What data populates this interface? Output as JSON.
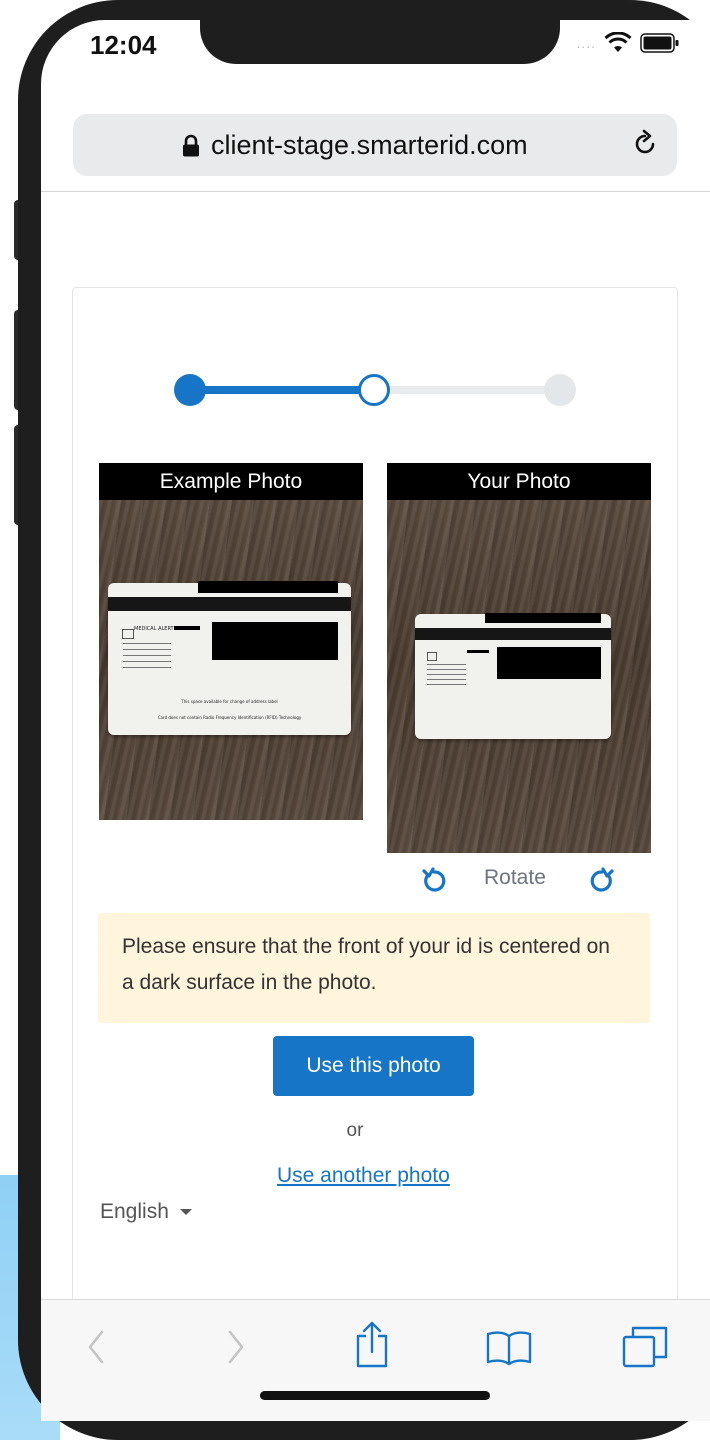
{
  "status_bar": {
    "time": "12:04"
  },
  "browser": {
    "url": "client-stage.smarterid.com"
  },
  "progress": {
    "current_step": 2,
    "total_steps": 3
  },
  "photos": {
    "example_title": "Example Photo",
    "yours_title": "Your Photo",
    "card_text_1": "MEDICAL ALERT",
    "card_text_2": "This space available for change of address label",
    "card_text_3": "Card does not contain Radio Frequency Identification (RFID) Technology"
  },
  "rotate": {
    "label": "Rotate"
  },
  "notice": {
    "text": "Please ensure that the front of your id is centered on a dark surface in the photo."
  },
  "actions": {
    "use_photo": "Use this photo",
    "or": "or",
    "use_another": "Use another photo"
  },
  "language": {
    "selected": "English"
  },
  "colors": {
    "accent": "#1775c7",
    "notice_bg": "#fef5dc",
    "progress_inactive": "#e3e7ea"
  },
  "icons": {
    "lock": "lock-icon",
    "reload": "reload-icon",
    "rotate_cw": "rotate-clockwise-icon",
    "rotate_ccw": "rotate-counterclockwise-icon",
    "back": "back-icon",
    "forward": "forward-icon",
    "share": "share-icon",
    "bookmarks": "bookmarks-icon",
    "tabs": "tabs-icon"
  }
}
